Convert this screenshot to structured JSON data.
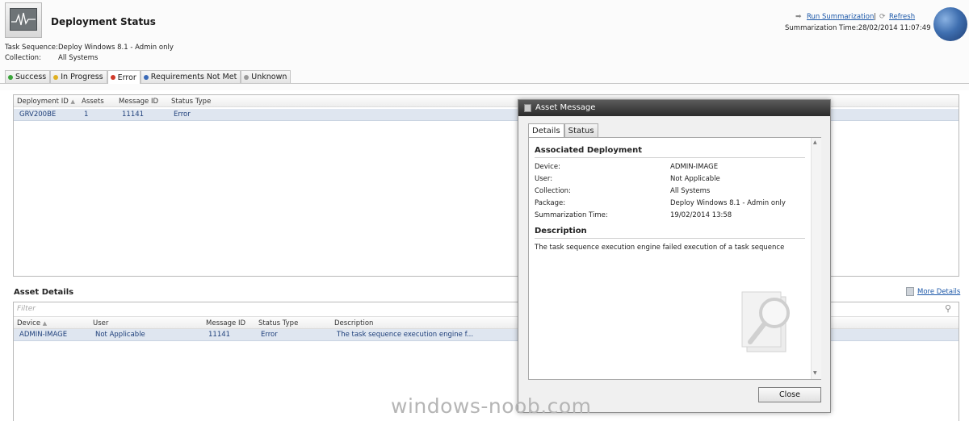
{
  "header": {
    "title": "Deployment Status",
    "task_sequence_label": "Task Sequence:",
    "task_sequence_value": "Deploy Windows 8.1 - Admin only",
    "collection_label": "Collection:",
    "collection_value": "All Systems",
    "run_summarization": "Run Summarization",
    "separator": "|",
    "refresh": "Refresh",
    "summarization_time": "Summarization Time:28/02/2014 11:07:49"
  },
  "tabs": [
    {
      "label": "Success",
      "color": "#3aa53a"
    },
    {
      "label": "In Progress",
      "color": "#e0b020"
    },
    {
      "label": "Error",
      "color": "#d03a2a"
    },
    {
      "label": "Requirements Not Met",
      "color": "#3a6ab8"
    },
    {
      "label": "Unknown",
      "color": "#9a9a9a"
    }
  ],
  "upper_grid": {
    "columns": [
      "Deployment ID",
      "Assets",
      "Message ID",
      "Status Type"
    ],
    "rows": [
      {
        "deployment_id": "GRV200BE",
        "assets": "1",
        "message_id": "11141",
        "status_type": "Error"
      }
    ]
  },
  "asset_details": {
    "title": "Asset Details",
    "more_details": "More Details",
    "filter_placeholder": "Filter",
    "columns": [
      "Device",
      "User",
      "Message ID",
      "Status Type",
      "Description"
    ],
    "rows": [
      {
        "device": "ADMIN-IMAGE",
        "user": "Not Applicable",
        "message_id": "11141",
        "status_type": "Error",
        "description": "The task sequence execution engine f..."
      }
    ]
  },
  "dialog": {
    "title": "Asset Message",
    "tabs": [
      "Details",
      "Status"
    ],
    "associated_deployment_title": "Associated Deployment",
    "fields": [
      {
        "label": "Device:",
        "value": "ADMIN-IMAGE"
      },
      {
        "label": "User:",
        "value": "Not Applicable"
      },
      {
        "label": "Collection:",
        "value": "All Systems"
      },
      {
        "label": "Package:",
        "value": "Deploy Windows 8.1 - Admin only"
      },
      {
        "label": "Summarization Time:",
        "value": "19/02/2014 13:58"
      }
    ],
    "description_title": "Description",
    "description_text": "The task sequence execution engine failed execution of a task sequence",
    "close_label": "Close"
  },
  "watermark": "windows-noob.com"
}
